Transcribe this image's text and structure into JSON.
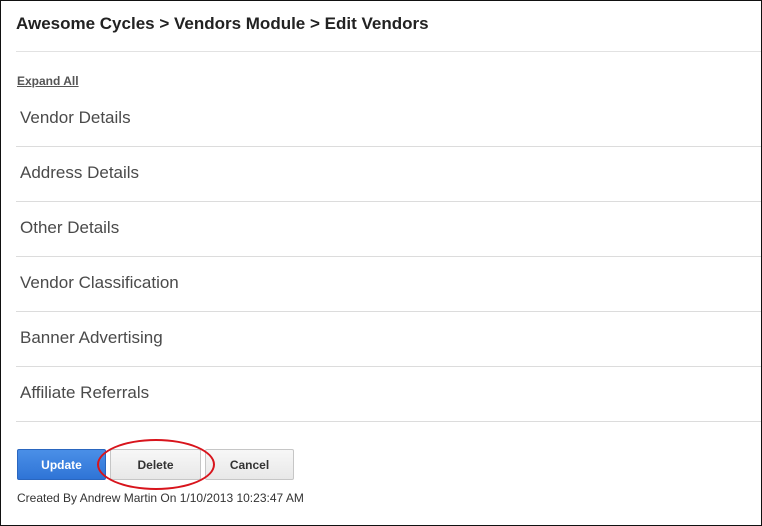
{
  "breadcrumb": {
    "title": "Awesome Cycles > Vendors Module > Edit Vendors"
  },
  "expand_all_label": "Expand All",
  "sections": [
    {
      "label": "Vendor Details"
    },
    {
      "label": "Address Details"
    },
    {
      "label": "Other Details"
    },
    {
      "label": "Vendor Classification"
    },
    {
      "label": "Banner Advertising"
    },
    {
      "label": "Affiliate Referrals"
    }
  ],
  "actions": {
    "update_label": "Update",
    "delete_label": "Delete",
    "cancel_label": "Cancel"
  },
  "footer": {
    "created_by": "Created By Andrew Martin On 1/10/2013 10:23:47 AM"
  },
  "colors": {
    "primary_button": "#3a80dd",
    "annotation_circle": "#d8141c"
  }
}
